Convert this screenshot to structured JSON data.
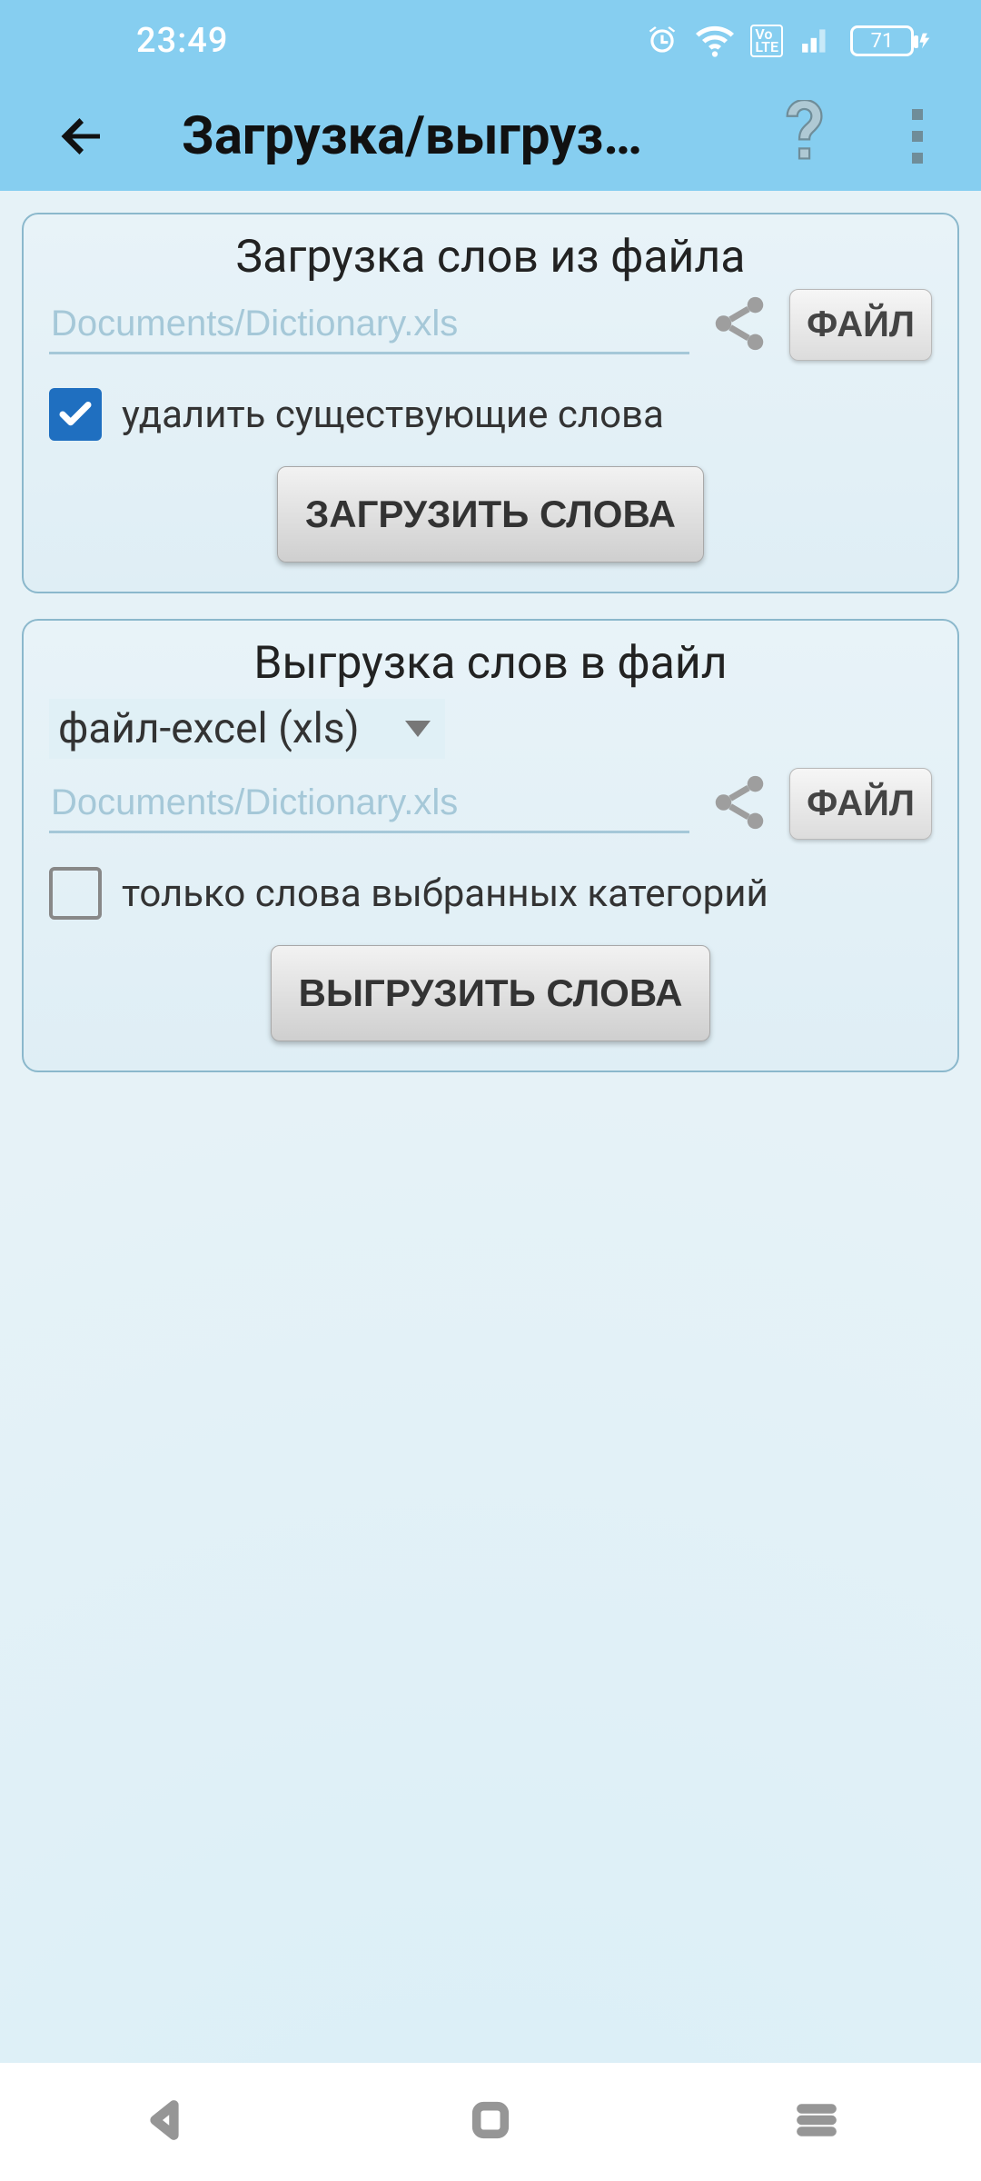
{
  "status": {
    "time": "23:49",
    "battery": "71"
  },
  "appbar": {
    "title": "Загрузка/выгруз…"
  },
  "load": {
    "title": "Загрузка слов из файла",
    "path_placeholder": "Documents/Dictionary.xls",
    "file_button": "ФАЙЛ",
    "delete_label": "удалить существующие слова",
    "action": "ЗАГРУЗИТЬ СЛОВА"
  },
  "unload": {
    "title": "Выгрузка слов в файл",
    "format_label": "файл-excel (xls)",
    "path_placeholder": "Documents/Dictionary.xls",
    "file_button": "ФАЙЛ",
    "only_label": "только слова выбранных категорий",
    "action": "ВЫГРУЗИТЬ СЛОВА"
  }
}
